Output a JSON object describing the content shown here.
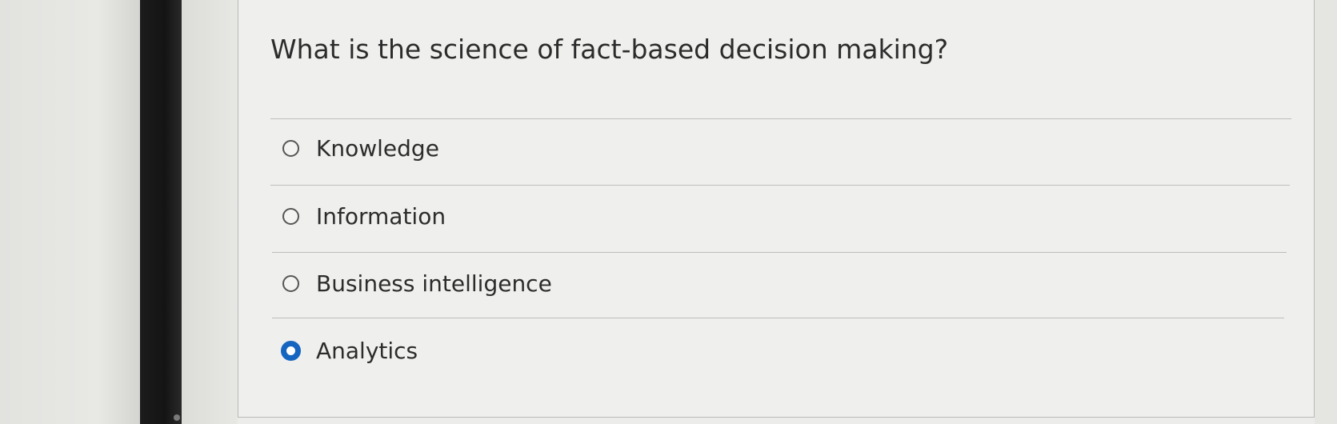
{
  "question": {
    "text": "What is the science of fact-based decision making?"
  },
  "options": [
    {
      "label": "Knowledge",
      "selected": false
    },
    {
      "label": "Information",
      "selected": false
    },
    {
      "label": "Business intelligence",
      "selected": false
    },
    {
      "label": "Analytics",
      "selected": true
    }
  ],
  "colors": {
    "selected_radio": "#1565c0",
    "text": "#2c2c2c",
    "panel_background": "#efefed",
    "divider": "#bdbdba"
  }
}
